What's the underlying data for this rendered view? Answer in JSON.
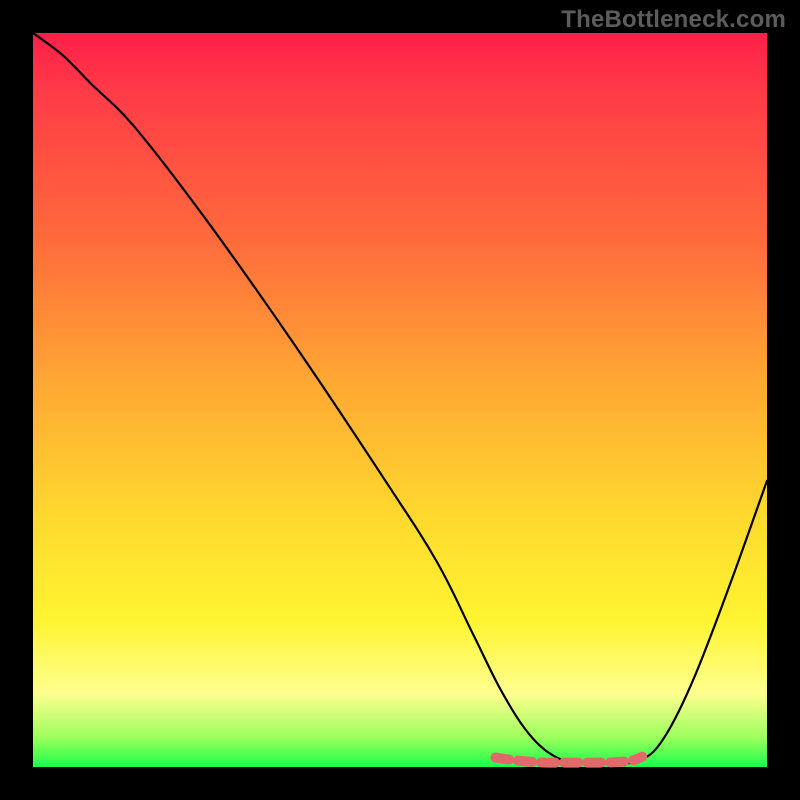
{
  "watermark": "TheBottleneck.com",
  "gradient_colors": {
    "top": "#ff1f48",
    "mid_upper": "#ff6a3c",
    "mid": "#ffd92e",
    "mid_lower": "#feff8f",
    "bottom": "#1cff49"
  },
  "curve_color": "#000000",
  "highlight_color": "#e06a6a",
  "chart_data": {
    "type": "line",
    "title": "",
    "xlabel": "",
    "ylabel": "",
    "xlim": [
      0,
      100
    ],
    "ylim": [
      0,
      100
    ],
    "series": [
      {
        "name": "bottleneck-curve",
        "x": [
          0,
          4,
          8,
          14,
          24,
          36,
          48,
          55,
          60,
          64,
          68,
          72,
          76,
          80,
          83,
          86,
          90,
          95,
          100
        ],
        "y": [
          100,
          97,
          93,
          87,
          74,
          57,
          39,
          28,
          18,
          10,
          4,
          1,
          0.5,
          0.5,
          1,
          4,
          12,
          25,
          39
        ]
      },
      {
        "name": "optimal-zone-highlight",
        "x": [
          63,
          65,
          68,
          71,
          74,
          77,
          80,
          82,
          83
        ],
        "y": [
          1.3,
          1.0,
          0.7,
          0.6,
          0.6,
          0.6,
          0.7,
          1.0,
          1.4
        ]
      }
    ],
    "note": "Values estimated from pixel positions; y expressed as percent of plot height from bottom."
  }
}
